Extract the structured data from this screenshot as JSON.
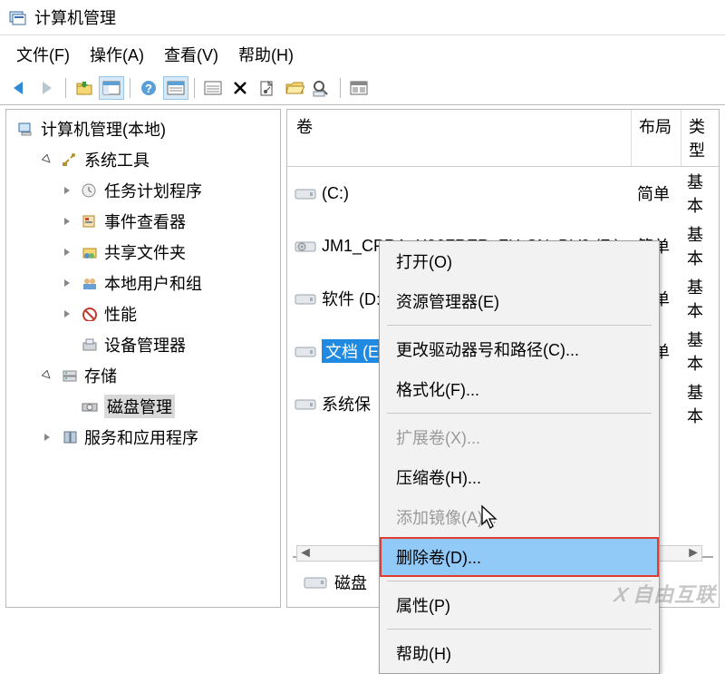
{
  "title": "计算机管理",
  "menu": {
    "file": "文件(F)",
    "action": "操作(A)",
    "view": "查看(V)",
    "help": "帮助(H)"
  },
  "tree": {
    "root": "计算机管理(本地)",
    "systemTools": "系统工具",
    "taskScheduler": "任务计划程序",
    "eventViewer": "事件查看器",
    "sharedFolders": "共享文件夹",
    "localUsers": "本地用户和组",
    "performance": "性能",
    "deviceManager": "设备管理器",
    "storage": "存储",
    "diskMgmt": "磁盘管理",
    "services": "服务和应用程序"
  },
  "list": {
    "headers": {
      "volume": "卷",
      "layout": "布局",
      "type": "类型"
    },
    "rows": [
      {
        "name": "(C:)",
        "layout": "简单",
        "type": "基本"
      },
      {
        "name": "JM1_CPRA_X86FRER_ZH-CN_DV9 (F:)",
        "layout": "简单",
        "type": "基本"
      },
      {
        "name": "软件 (D:)",
        "layout": "简单",
        "type": "基本"
      },
      {
        "name": "文档 (E:)",
        "layout": "简单",
        "type": "基本",
        "selected": true
      },
      {
        "name": "系统保",
        "layout": "",
        "type": "基本"
      }
    ]
  },
  "contextMenu": {
    "open": "打开(O)",
    "explorer": "资源管理器(E)",
    "changeDrive": "更改驱动器号和路径(C)...",
    "format": "格式化(F)...",
    "extend": "扩展卷(X)...",
    "shrink": "压缩卷(H)...",
    "addMirror": "添加镜像(A)...",
    "deleteVolume": "删除卷(D)...",
    "properties": "属性(P)",
    "help": "帮助(H)"
  },
  "bottom": {
    "disk": "磁盘"
  },
  "watermark": "自由互联"
}
